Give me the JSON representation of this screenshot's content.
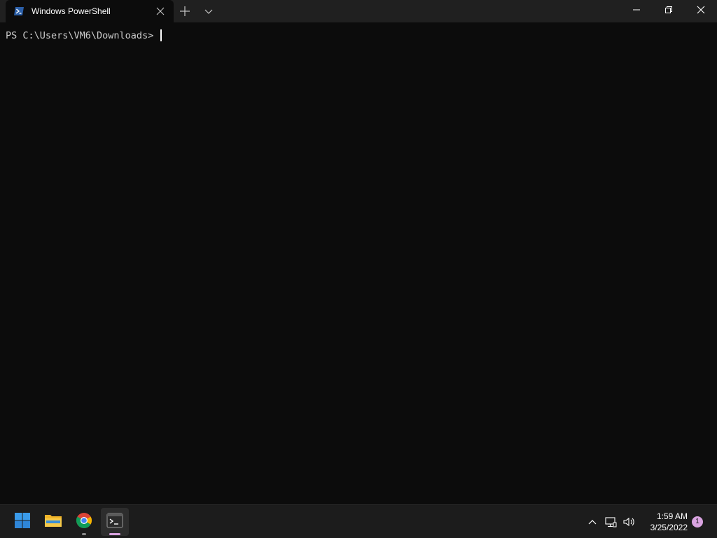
{
  "window": {
    "tab_title": "Windows PowerShell",
    "tab_icon": "powershell-icon",
    "new_tab_icon": "plus-icon",
    "dropdown_icon": "chevron-down-icon",
    "controls": [
      "minimize-icon",
      "restore-icon",
      "close-icon"
    ]
  },
  "terminal": {
    "prompt": "PS C:\\Users\\VM6\\Downloads> "
  },
  "taskbar": {
    "items": [
      {
        "name": "start",
        "icon": "windows-logo-icon"
      },
      {
        "name": "file-explorer",
        "icon": "folder-icon"
      },
      {
        "name": "chrome",
        "icon": "chrome-icon",
        "running": true
      },
      {
        "name": "terminal",
        "icon": "terminal-icon",
        "active": true
      }
    ],
    "tray": {
      "time": "1:59 AM",
      "date": "3/25/2022",
      "notification_count": "1"
    }
  },
  "colors": {
    "background": "#0c0c0c",
    "titlebar": "#202020",
    "taskbar": "#1c1c1c",
    "accent": "#d9a3e0",
    "text": "#cccccc"
  }
}
